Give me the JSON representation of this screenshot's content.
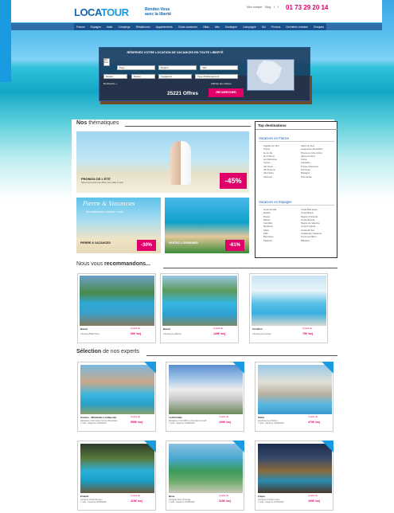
{
  "header": {
    "logo_a": "LOCA",
    "logo_b": "TOUR",
    "tagline_l1": "Rendez-Vous",
    "tagline_l2": "avec la liberté",
    "links": [
      "Mon compte",
      "Blog",
      "f",
      "t"
    ],
    "phone": "01 73 29 20 14"
  },
  "nav": [
    "France",
    "Espagne",
    "Italie",
    "Campings",
    "Résidences",
    "Appartements",
    "Clubs vacances",
    "Villas",
    "Mer",
    "Montagne",
    "Campagne",
    "Ski",
    "Promos",
    "Dernières minutes",
    "Groupes"
  ],
  "search": {
    "title": "RÉSERVEZ VOTRE LOCATION DE VACANCES EN TOUTE LIBERTÉ",
    "dest_label": "Nos Dest.",
    "country": "Pays",
    "region": "Région",
    "city": "Ville",
    "depart": "Départ",
    "retour": "Retour",
    "voyageurs": "Voyageurs",
    "type": "Type d'hébergement",
    "adv_left": "Recherche +",
    "adv_right": "Afficher les critères",
    "offers": "25221 Offres",
    "button": "RECHERCHER"
  },
  "themes": {
    "heading_pre": "Nos",
    "heading_bold": "thématiques",
    "promo_title": "PROMOS DE L'ÉTÉ",
    "promo_sub": "Retrouvez toutes nos offres pour juillet et août",
    "promo_discount": "-45%",
    "pv_logo": "Pierre & Vacances",
    "pv_tag": "les vacances comme vous",
    "pv_title": "PIERRE & VACANCES",
    "pv_discount": "-30%",
    "p2_title": "PARTEZ 2 SEMAINES",
    "p2_discount": "-61%"
  },
  "sidebar": {
    "title": "Top destinations",
    "france_title": "Vacances en France",
    "france_col1": [
      "Argelès sur Mer",
      "Fréjus",
      "Ile de Ré",
      "Ile d'Oléron",
      "Les Menuires",
      "Tignes",
      "Val Cenis",
      "Val Thorens",
      "Val d'Isère",
      "Valmorel"
    ],
    "france_col2": [
      "Alpes du Sud",
      "Languedoc Roussillon",
      "Provence Côte d'Azur",
      "Alpes du Nord",
      "Corse",
      "Aquitaine",
      "Poitou-Charentes",
      "Pyrénées",
      "Bretagne",
      "Normandie"
    ],
    "spain_title": "Vacances en Espagne",
    "spain_col1": [
      "Lloret de Mar",
      "Estartit",
      "Rosas",
      "Blanes",
      "Cambrils",
      "Benidorm",
      "Salou",
      "Palé",
      "Barcelone",
      "Palamos"
    ],
    "spain_col2": [
      "Costa Barcelona",
      "Costa Brava",
      "Région d'Almeria",
      "Costa Dorada",
      "Région de Valence",
      "Costa Tropical",
      "Costa del Sol",
      "Andalousie intérieure",
      "Terres de l'Ebre",
      "Baléares"
    ]
  },
  "recommend": {
    "heading_pre": "Nous vous",
    "heading_bold": "recommandons...",
    "items": [
      {
        "name": "Biarac",
        "sub": "Camping Bella Torra",
        "from": "À partir de",
        "price": "66€ /sej"
      },
      {
        "name": "Biarac",
        "sub": "Camping La Marina",
        "from": "À partir de",
        "price": "149€ /sej"
      },
      {
        "name": "Tornillon",
        "sub": "Camping Les Dunes",
        "from": "À partir de",
        "price": "79€ /sej"
      }
    ]
  },
  "experts": {
    "heading_bold": "Sélection",
    "heading_post": "de nos experts",
    "items": [
      {
        "name": "Cannes - Mandelieu La Napoule",
        "sub": "Résidence Club Vestel Cannes Mandelieu",
        "date": "7 nuits - départ le 21/06/2015",
        "from": "À partir de",
        "price": "559€ /sej"
      },
      {
        "name": "La Rochelle",
        "sub": "Résidence Club MMV Le Domaine du Golf",
        "date": "7 nuits - départ le 13/06/2015",
        "from": "À partir de",
        "price": "199€ /sej"
      },
      {
        "name": "Salou",
        "sub": "Aparthotel Les Palmer",
        "date": "7 nuits - départ le 13/06/2015",
        "from": "À partir de",
        "price": "479€ /sej"
      },
      {
        "name": "Estartit",
        "sub": "Camping Castell Montgrí",
        "date": "7 nuits - départ le 20/06/2015",
        "from": "À partir de",
        "price": "119€ /sej"
      },
      {
        "name": "Blois",
        "sub": "Camping Sous Ombrage",
        "date": "7 nuits - départ le 27/06/2015",
        "from": "À partir de",
        "price": "119€ /sej"
      },
      {
        "name": "Fréjus",
        "sub": "Camping La Pierre Verte",
        "date": "7 nuits - départ le 27/06/2015",
        "from": "À partir de",
        "price": "199€ /sej"
      }
    ]
  }
}
